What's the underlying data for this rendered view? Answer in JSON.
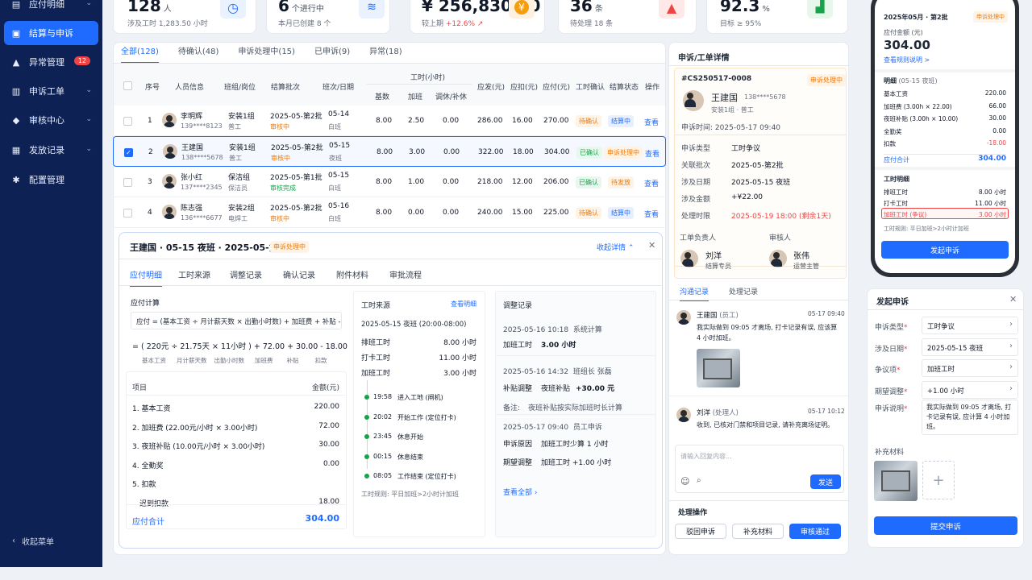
{
  "sidebar": {
    "items": [
      "应付明细",
      "结算与申诉",
      "异常管理",
      "申诉工单",
      "审核中心",
      "发放记录",
      "配置管理"
    ],
    "badge": "12",
    "collapse": "收起菜单"
  },
  "kpis": [
    {
      "value": "128",
      "unit": "人",
      "sub": "涉及工时 1,283.50 小时"
    },
    {
      "value": "6",
      "unit": "个进行中",
      "sub": "本月已创建 8 个"
    },
    {
      "value": "¥ 256,830.50",
      "unit": "",
      "sub": "较上期",
      "delta": "+12.6%"
    },
    {
      "value": "36",
      "unit": "条",
      "sub": "待处理 18 条"
    },
    {
      "value": "92.3",
      "unit": "%",
      "sub": "目标 ≥ 95%"
    }
  ],
  "tabs": [
    "全部(128)",
    "待确认(48)",
    "申诉处理中(15)",
    "已申诉(9)",
    "异常(18)"
  ],
  "table": {
    "headers": [
      "序号",
      "人员信息",
      "班组/岗位",
      "结算批次",
      "班次/日期",
      "工时(小时)",
      "基数",
      "加班",
      "调休/补休",
      "应发(元)",
      "应扣(元)",
      "应付(元)",
      "工时确认",
      "结算状态",
      "操作"
    ],
    "rows": [
      {
        "no": "1",
        "name": "李明辉",
        "phone": "139****8123",
        "team": "安装1组",
        "post": "普工",
        "batch": "2025-05-第2批",
        "bstat": "审核中",
        "date": "05-14",
        "shift": "白班",
        "base": "8.00",
        "ot": "2.50",
        "rest": "0.00",
        "pay": "286.00",
        "ded": "16.00",
        "net": "270.00",
        "confirm": "待确认",
        "status": "结算中",
        "op": "查看"
      },
      {
        "no": "2",
        "name": "王建国",
        "phone": "138****5678",
        "team": "安装1组",
        "post": "普工",
        "batch": "2025-05-第2批",
        "bstat": "审核中",
        "date": "05-15",
        "shift": "夜班",
        "base": "8.00",
        "ot": "3.00",
        "rest": "0.00",
        "pay": "322.00",
        "ded": "18.00",
        "net": "304.00",
        "confirm": "已确认",
        "status": "申诉处理中",
        "op": "查看"
      },
      {
        "no": "3",
        "name": "张小红",
        "phone": "137****2345",
        "team": "保洁组",
        "post": "保洁员",
        "batch": "2025-05-第1批",
        "bstat": "审核完成",
        "date": "05-15",
        "shift": "白班",
        "base": "8.00",
        "ot": "1.00",
        "rest": "0.00",
        "pay": "218.00",
        "ded": "12.00",
        "net": "206.00",
        "confirm": "已确认",
        "status": "待发放",
        "op": "查看"
      },
      {
        "no": "4",
        "name": "陈志强",
        "phone": "136****6677",
        "team": "安装2组",
        "post": "电焊工",
        "batch": "2025-05-第2批",
        "bstat": "审核中",
        "date": "05-16",
        "shift": "白班",
        "base": "8.00",
        "ot": "0.00",
        "rest": "0.00",
        "pay": "240.00",
        "ded": "15.00",
        "net": "225.00",
        "confirm": "待确认",
        "status": "结算中",
        "op": "查看"
      }
    ]
  },
  "detail": {
    "title": "王建国 · 05-15 夜班 · 2025-05-第2批",
    "tag": "申诉处理中",
    "collapse": "收起详情",
    "tabs": [
      "应付明细",
      "工时来源",
      "调整记录",
      "确认记录",
      "附件材料",
      "审批流程"
    ],
    "calc_title": "应付计算",
    "formula": "应付 = (基本工资 ÷ 月计薪天数 × 出勤小时数) + 加班费 + 补贴 - 扣款",
    "calc": "= ( 220元 ÷ 21.75天 × 11小时 ) + 72.00 + 30.00 - 18.00",
    "calc_labels": [
      "基本工资",
      "月计薪天数",
      "出勤小时数",
      "加班费",
      "补贴",
      "扣款"
    ],
    "item_head": [
      "项目",
      "金额(元)"
    ],
    "items": [
      [
        "1. 基本工资",
        "220.00"
      ],
      [
        "2. 加班费 (22.00元/小时 × 3.00小时)",
        "72.00"
      ],
      [
        "3. 夜班补贴 (10.00元/小时 × 3.00小时)",
        "30.00"
      ],
      [
        "4. 全勤奖",
        "0.00"
      ],
      [
        "5. 扣款",
        ""
      ],
      [
        "迟到扣款",
        "18.00"
      ]
    ],
    "total_label": "应付合计",
    "total": "304.00",
    "src_title": "工时来源",
    "src_link": "查看明细",
    "src_sub": "2025-05-15 夜班 (20:00-08:00)",
    "src_rows": [
      [
        "排班工时",
        "8.00 小时"
      ],
      [
        "打卡工时",
        "11.00 小时"
      ],
      [
        "加班工时",
        "3.00 小时"
      ]
    ],
    "timeline": [
      [
        "19:58",
        "进入工地 (闸机)"
      ],
      [
        "20:02",
        "开始工作 (定位打卡)"
      ],
      [
        "23:45",
        "休息开始"
      ],
      [
        "00:15",
        "休息结束"
      ],
      [
        "08:05",
        "工作结束 (定位打卡)"
      ]
    ],
    "rule": "工时规则: 平日加班>2小时计加班",
    "adj_title": "调整记录",
    "adj": [
      {
        "t": "2025-05-16 10:18",
        "who": "系统计算",
        "k": "加班工时",
        "v": "3.00 小时"
      },
      {
        "t": "2025-05-16 14:32",
        "who": "班组长 张磊",
        "k": "补贴调整",
        "k2": "夜班补贴",
        "v": "+30.00 元",
        "note_k": "备注:",
        "note": "夜班补贴按实际加班时长计算"
      },
      {
        "t": "2025-05-17 09:40",
        "who": "员工申诉",
        "k": "申诉原因",
        "k2": "加班工时少算 1 小时",
        "k3": "期望调整",
        "k4": "加班工时 +1.00 小时"
      }
    ],
    "adj_all": "查看全部"
  },
  "ticket": {
    "title": "申诉/工单详情",
    "id": "#CS250517-0008",
    "tag": "申诉处理中",
    "name": "王建国",
    "phone": "138****5678",
    "team": "安装1组 · 普工",
    "time_l": "申诉时间:",
    "time": "2025-05-17 09:40",
    "fields": [
      [
        "申诉类型",
        "工时争议"
      ],
      [
        "关联批次",
        "2025-05-第2批"
      ],
      [
        "涉及日期",
        "2025-05-15 夜班"
      ],
      [
        "涉及金额",
        "+¥22.00"
      ],
      [
        "处理时限",
        "2025-05-19 18:00 (剩余1天)"
      ]
    ],
    "owner_l": "工单负责人",
    "owner": "刘洋",
    "owner_role": "结算专员",
    "auditor_l": "审核人",
    "auditor": "张伟",
    "auditor_role": "运营主管",
    "tabs": [
      "沟通记录",
      "处理记录"
    ],
    "msgs": [
      {
        "name": "王建国",
        "role": "(员工)",
        "time": "05-17 09:40",
        "text": "我实际做到 09:05 才离场, 打卡记录有误, 应该算 4 小时加班。"
      },
      {
        "name": "刘洋",
        "role": "(处理人)",
        "time": "05-17 10:12",
        "text": "收到, 已核对门禁和项目记录, 请补充离场证明。"
      }
    ],
    "reply_ph": "请输入回复内容...",
    "send": "发送",
    "ops_title": "处理操作",
    "ops": [
      "驳回申诉",
      "补充材料",
      "审核通过"
    ]
  },
  "mobile": {
    "batch": "2025年05月 · 第2批",
    "tag": "申诉处理中",
    "amt_l": "应付金额 (元)",
    "amt": "304.00",
    "rule_link": "查看规则说明 >",
    "detail_l": "明细",
    "detail_sub": "(05-15 夜班)",
    "rows": [
      [
        "基本工资",
        "220.00"
      ],
      [
        "加班费 (3.00h × 22.00)",
        "66.00"
      ],
      [
        "夜班补贴 (3.00h × 10.00)",
        "30.00"
      ],
      [
        "全勤奖",
        "0.00"
      ],
      [
        "扣款",
        "-18.00"
      ]
    ],
    "total_l": "应付合计",
    "total": "304.00",
    "hours_l": "工时明细",
    "hours": [
      [
        "排班工时",
        "8.00 小时"
      ],
      [
        "打卡工时",
        "11.00 小时"
      ],
      [
        "加班工时 (争议)",
        "3.00 小时"
      ]
    ],
    "rule": "工时规则: 平日加班>2小时计加班",
    "btn": "发起申诉"
  },
  "appeal": {
    "title": "发起申诉",
    "fields": [
      [
        "申诉类型",
        "工时争议"
      ],
      [
        "涉及日期",
        "2025-05-15 夜班"
      ],
      [
        "争议项",
        "加班工时"
      ],
      [
        "期望调整",
        "+1.00 小时"
      ]
    ],
    "desc_l": "申诉说明",
    "desc": "我实际做到 09:05 才离场, 打卡记录有误, 应计算 4 小时加班。",
    "att_l": "补充材料",
    "submit": "提交申诉"
  }
}
